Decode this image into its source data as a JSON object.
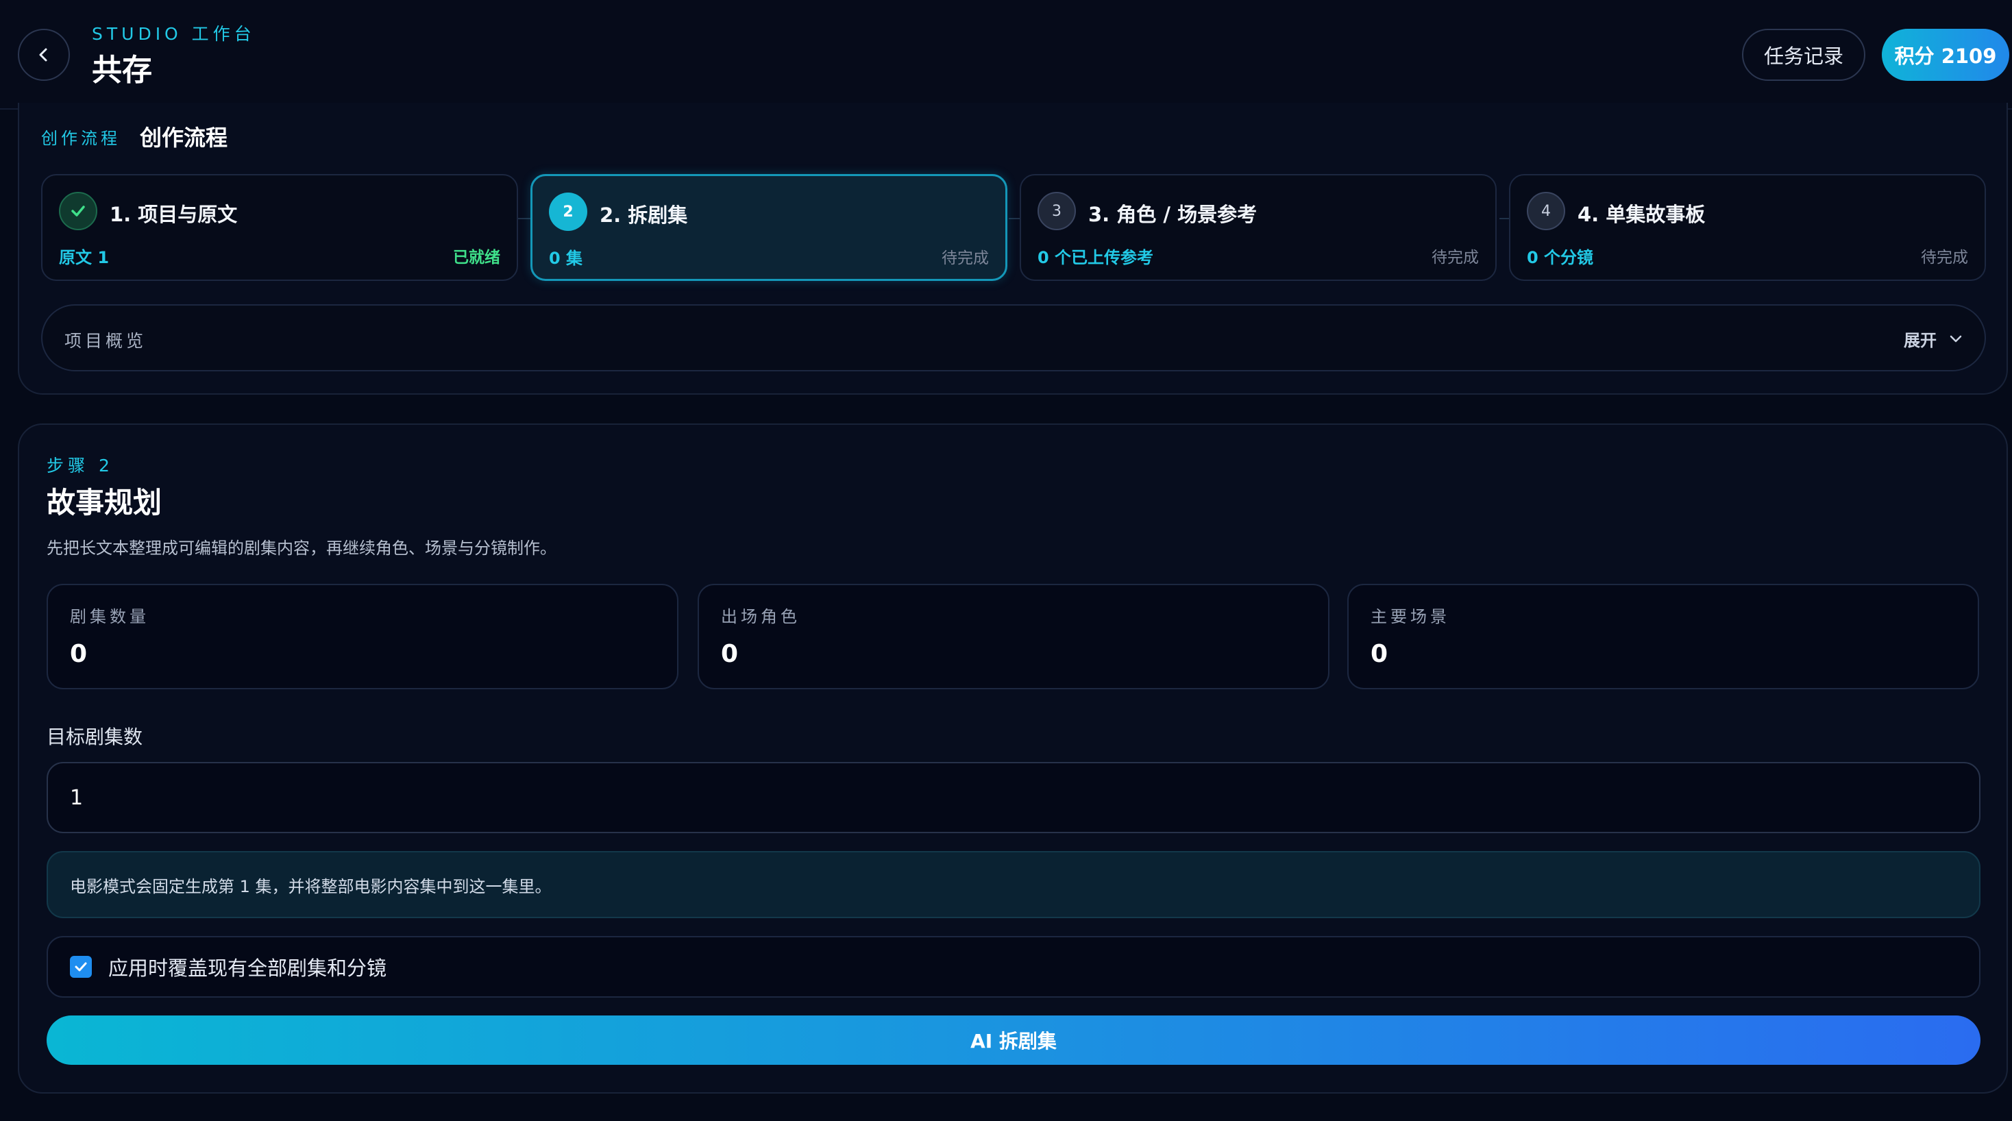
{
  "header": {
    "studio_label": "STUDIO 工作台",
    "title": "共存",
    "task_button": "任务记录",
    "points_button": "积分 2109"
  },
  "workflow": {
    "subtitle": "创作流程",
    "title": "创作流程",
    "steps": [
      {
        "number": "1",
        "title": "1. 项目与原文",
        "count": "原文 1",
        "status": "已就绪",
        "state": "done"
      },
      {
        "number": "2",
        "title": "2. 拆剧集",
        "count": "0 集",
        "status": "待完成",
        "state": "current"
      },
      {
        "number": "3",
        "title": "3. 角色 / 场景参考",
        "count": "0 个已上传参考",
        "status": "待完成",
        "state": "pending"
      },
      {
        "number": "4",
        "title": "4. 单集故事板",
        "count": "0 个分镜",
        "status": "待完成",
        "state": "pending"
      }
    ],
    "overview_label": "项目概览",
    "expand_label": "展开"
  },
  "panel": {
    "step_label": "步骤 2",
    "title": "故事规划",
    "description": "先把长文本整理成可编辑的剧集内容，再继续角色、场景与分镜制作。",
    "stats": [
      {
        "label": "剧集数量",
        "value": "0"
      },
      {
        "label": "出场角色",
        "value": "0"
      },
      {
        "label": "主要场景",
        "value": "0"
      }
    ],
    "target_label": "目标剧集数",
    "target_value": "1",
    "notice": "电影模式会固定生成第 1 集，并将整部电影内容集中到这一集里。",
    "overwrite_label": "应用时覆盖现有全部剧集和分镜",
    "overwrite_checked": true,
    "ai_button": "AI 拆剧集"
  },
  "colors": {
    "accent": "#22c9e6",
    "ready": "#3fe08a",
    "background": "#050a18",
    "button_gradient_start": "#0ab6d4",
    "button_gradient_end": "#2a6cf0"
  }
}
